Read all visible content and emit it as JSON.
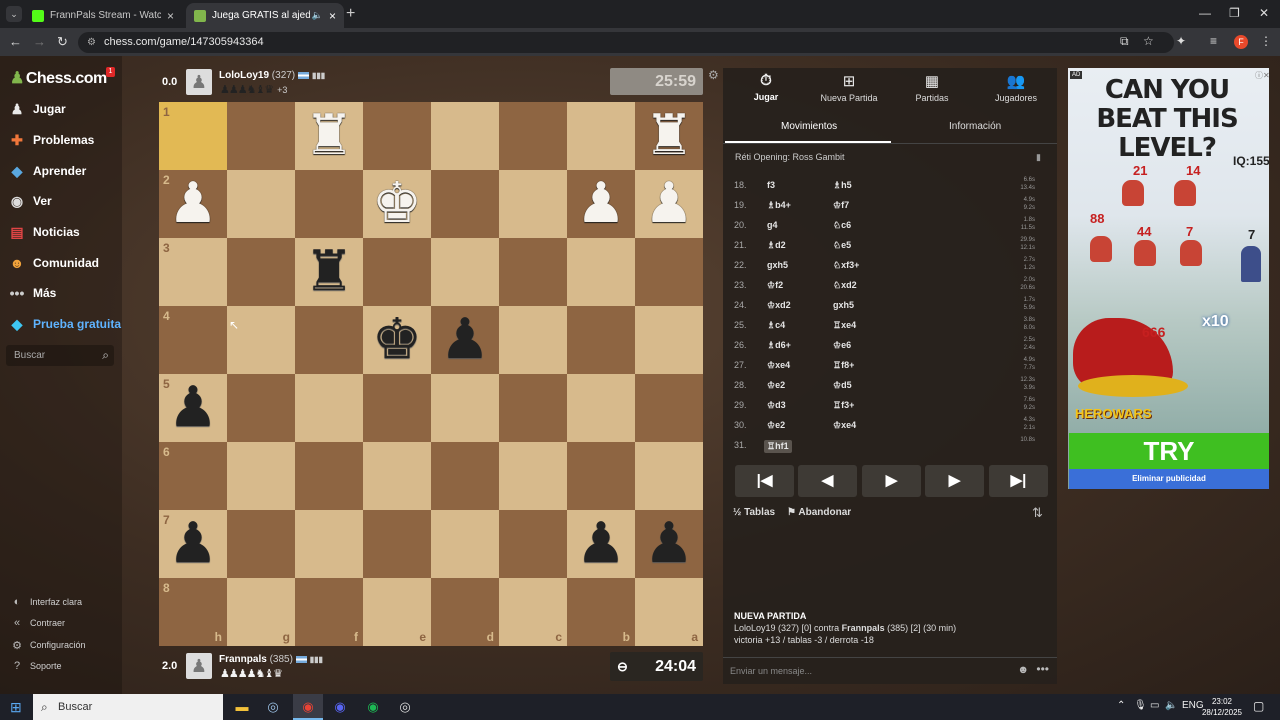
{
  "browser": {
    "tabs": [
      {
        "title": "FrannPals Stream - Watch Live o",
        "favicon_color": "#53fc18"
      },
      {
        "title": "Juega GRATIS al ajedrez onli",
        "favicon_color": "#81b64c"
      }
    ],
    "url": "chess.com/game/147305943364"
  },
  "sidebar": {
    "logo": "Chess.com",
    "notification_count": "1",
    "items": [
      {
        "label": "Jugar",
        "icon": "play-icon"
      },
      {
        "label": "Problemas",
        "icon": "puzzle-icon"
      },
      {
        "label": "Aprender",
        "icon": "learn-icon"
      },
      {
        "label": "Ver",
        "icon": "watch-icon"
      },
      {
        "label": "Noticias",
        "icon": "news-icon"
      },
      {
        "label": "Comunidad",
        "icon": "community-icon"
      },
      {
        "label": "Más",
        "icon": "more-icon"
      },
      {
        "label": "Prueba gratuita",
        "icon": "diamond-icon"
      }
    ],
    "search_placeholder": "Buscar",
    "footer": [
      {
        "label": "Interfaz clara",
        "icon": "half-moon-icon"
      },
      {
        "label": "Contraer",
        "icon": "collapse-icon"
      },
      {
        "label": "Configuración",
        "icon": "gear-icon"
      },
      {
        "label": "Soporte",
        "icon": "help-icon"
      }
    ]
  },
  "top_player": {
    "score": "0.0",
    "name": "LoloLoy19",
    "rating": "(327)",
    "captured": "♟♟♟♞♝♛",
    "advantage": "+3",
    "clock": "25:59"
  },
  "bottom_player": {
    "score": "2.0",
    "name": "Frannpals",
    "rating": "(385)",
    "captured": "♟♟♟♟♞♝♛",
    "clock": "24:04"
  },
  "board": {
    "ranks": [
      "1",
      "2",
      "3",
      "4",
      "5",
      "6",
      "7",
      "8"
    ],
    "files": [
      "h",
      "g",
      "f",
      "e",
      "d",
      "c",
      "b",
      "a"
    ],
    "highlight": [
      {
        "row": 0,
        "col": 0
      }
    ],
    "pieces": [
      {
        "row": 0,
        "col": 2,
        "glyph": "♜",
        "color": "w"
      },
      {
        "row": 0,
        "col": 7,
        "glyph": "♜",
        "color": "w"
      },
      {
        "row": 1,
        "col": 0,
        "glyph": "♟",
        "color": "w"
      },
      {
        "row": 1,
        "col": 3,
        "glyph": "♚",
        "color": "w"
      },
      {
        "row": 1,
        "col": 6,
        "glyph": "♟",
        "color": "w"
      },
      {
        "row": 1,
        "col": 7,
        "glyph": "♟",
        "color": "w"
      },
      {
        "row": 2,
        "col": 2,
        "glyph": "♜",
        "color": "b"
      },
      {
        "row": 3,
        "col": 3,
        "glyph": "♚",
        "color": "b"
      },
      {
        "row": 3,
        "col": 4,
        "glyph": "♟",
        "color": "b"
      },
      {
        "row": 4,
        "col": 0,
        "glyph": "♟",
        "color": "b"
      },
      {
        "row": 6,
        "col": 0,
        "glyph": "♟",
        "color": "b"
      },
      {
        "row": 6,
        "col": 6,
        "glyph": "♟",
        "color": "b"
      },
      {
        "row": 6,
        "col": 7,
        "glyph": "♟",
        "color": "b"
      }
    ]
  },
  "panel": {
    "tabs": [
      {
        "label": "Jugar",
        "icon": "stopwatch-icon"
      },
      {
        "label": "Nueva Partida",
        "icon": "plus-icon"
      },
      {
        "label": "Partidas",
        "icon": "board-icon"
      },
      {
        "label": "Jugadores",
        "icon": "players-icon"
      }
    ],
    "subtabs": [
      "Movimientos",
      "Información"
    ],
    "opening": "Réti Opening: Ross Gambit",
    "moves": [
      {
        "num": "18.",
        "white": "f3",
        "black": "♗h5",
        "wt": "6.6s",
        "bt": "13.4s"
      },
      {
        "num": "19.",
        "white": "♗b4+",
        "black": "♔f7",
        "wt": "4.9s",
        "bt": "9.2s"
      },
      {
        "num": "20.",
        "white": "g4",
        "black": "♘c6",
        "wt": "1.8s",
        "bt": "11.5s"
      },
      {
        "num": "21.",
        "white": "♗d2",
        "black": "♘e5",
        "wt": "29.9s",
        "bt": "12.1s"
      },
      {
        "num": "22.",
        "white": "gxh5",
        "black": "♘xf3+",
        "wt": "2.7s",
        "bt": "1.2s"
      },
      {
        "num": "23.",
        "white": "♔f2",
        "black": "♘xd2",
        "wt": "2.0s",
        "bt": "20.6s"
      },
      {
        "num": "24.",
        "white": "♔xd2",
        "black": "gxh5",
        "wt": "1.7s",
        "bt": "5.9s"
      },
      {
        "num": "25.",
        "white": "♗c4",
        "black": "♖xe4",
        "wt": "3.8s",
        "bt": "8.0s"
      },
      {
        "num": "26.",
        "white": "♗d6+",
        "black": "♔e6",
        "wt": "2.5s",
        "bt": "2.4s"
      },
      {
        "num": "27.",
        "white": "♔xe4",
        "black": "♖f8+",
        "wt": "4.9s",
        "bt": "7.7s"
      },
      {
        "num": "28.",
        "white": "♔e2",
        "black": "♔d5",
        "wt": "12.3s",
        "bt": "3.9s"
      },
      {
        "num": "29.",
        "white": "♔d3",
        "black": "♖f3+",
        "wt": "7.6s",
        "bt": "9.2s"
      },
      {
        "num": "30.",
        "white": "♔e2",
        "black": "♔xe4",
        "wt": "4.3s",
        "bt": "2.1s"
      },
      {
        "num": "31.",
        "white": "♖hf1",
        "black": "",
        "wt": "10.8s",
        "bt": ""
      }
    ],
    "controls": [
      "|◀",
      "◀",
      "▶",
      "▶",
      "▶|"
    ],
    "draw_label": "Tablas",
    "resign_label": "Abandonar",
    "newgame_title": "NUEVA PARTIDA",
    "newgame_line1_pre": "LoloLoy19 (327) [0] contra ",
    "newgame_line1_name": "Frannpals",
    "newgame_line1_post": " (385) [2] (30 min)",
    "newgame_line2": "victoria +13 / tablas -3 / derrota -18",
    "chat_placeholder": "Enviar un mensaje..."
  },
  "ad": {
    "label": "AD",
    "headline": "CAN YOU BEAT THIS LEVEL?",
    "iq": "IQ:155",
    "numbers": [
      "21",
      "14",
      "88",
      "44",
      "7",
      "7"
    ],
    "big_number": "666",
    "multiplier": "x10",
    "logo": "HEROWARS",
    "cta": "TRY",
    "remove_label": "Eliminar publicidad"
  },
  "taskbar": {
    "search": "Buscar",
    "lang": "ENG",
    "time": "23:02",
    "date": "28/12/2025"
  }
}
